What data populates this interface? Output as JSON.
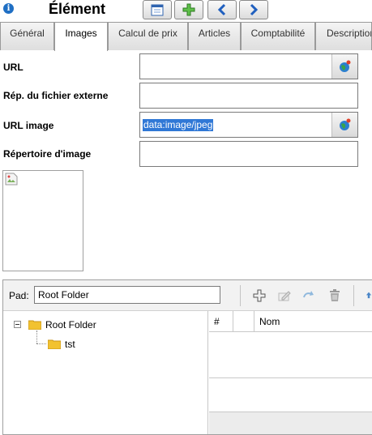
{
  "header": {
    "title": "Élément",
    "buttons": [
      {
        "icon": "calendar-icon"
      },
      {
        "icon": "add-icon"
      },
      {
        "icon": "previous-arrow-icon"
      },
      {
        "icon": "next-arrow-icon"
      }
    ]
  },
  "tabs": [
    {
      "label": "Général",
      "active": false
    },
    {
      "label": "Images",
      "active": true
    },
    {
      "label": "Calcul de prix",
      "active": false
    },
    {
      "label": "Articles",
      "active": false
    },
    {
      "label": "Comptabilité",
      "active": false
    },
    {
      "label": "Description",
      "active": false
    }
  ],
  "form": {
    "url_label": "URL",
    "url_value": "",
    "ext_dir_label": "Rép. du fichier externe",
    "ext_dir_value": "",
    "image_url_label": "URL image",
    "image_url_value": "data:image/jpeg",
    "image_dir_label": "Répertoire d'image",
    "image_dir_value": ""
  },
  "folder_panel": {
    "pad_label": "Pad:",
    "pad_value": "Root Folder",
    "toolbar_icons": [
      "add-folder-icon",
      "rename-icon",
      "refresh-icon",
      "delete-icon",
      "upload-icon"
    ],
    "tree": {
      "root": "Root Folder",
      "children": [
        "tst"
      ]
    },
    "grid_columns": [
      "#",
      "",
      "Nom"
    ]
  },
  "colors": {
    "selection": "#3078d6",
    "accent_blue": "#1f6fc4",
    "folder_yellow": "#f2c230"
  }
}
